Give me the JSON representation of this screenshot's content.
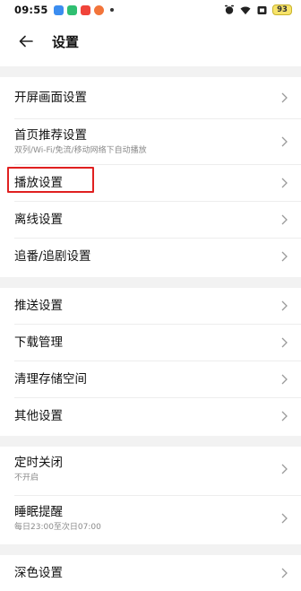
{
  "status_bar": {
    "time": "09:55",
    "battery": "93",
    "accent_battery": "#f7e36a"
  },
  "header": {
    "title": "设置",
    "back_icon": "arrow-left-icon"
  },
  "sections": [
    {
      "items": [
        {
          "label": "开屏画面设置",
          "sub": ""
        },
        {
          "label": "首页推荐设置",
          "sub": "双列/Wi-Fi/免流/移动网络下自动播放"
        },
        {
          "label": "播放设置",
          "sub": "",
          "highlighted": true
        },
        {
          "label": "离线设置",
          "sub": ""
        },
        {
          "label": "追番/追剧设置",
          "sub": ""
        }
      ]
    },
    {
      "items": [
        {
          "label": "推送设置",
          "sub": ""
        },
        {
          "label": "下载管理",
          "sub": ""
        },
        {
          "label": "清理存储空间",
          "sub": ""
        },
        {
          "label": "其他设置",
          "sub": ""
        }
      ]
    },
    {
      "items": [
        {
          "label": "定时关闭",
          "sub": "不开启"
        },
        {
          "label": "睡眠提醒",
          "sub": "每日23:00至次日07:00"
        }
      ]
    },
    {
      "items": [
        {
          "label": "深色设置",
          "sub": ""
        }
      ]
    }
  ],
  "colors": {
    "highlight_border": "#e02020",
    "section_gap": "#f2f2f2"
  }
}
